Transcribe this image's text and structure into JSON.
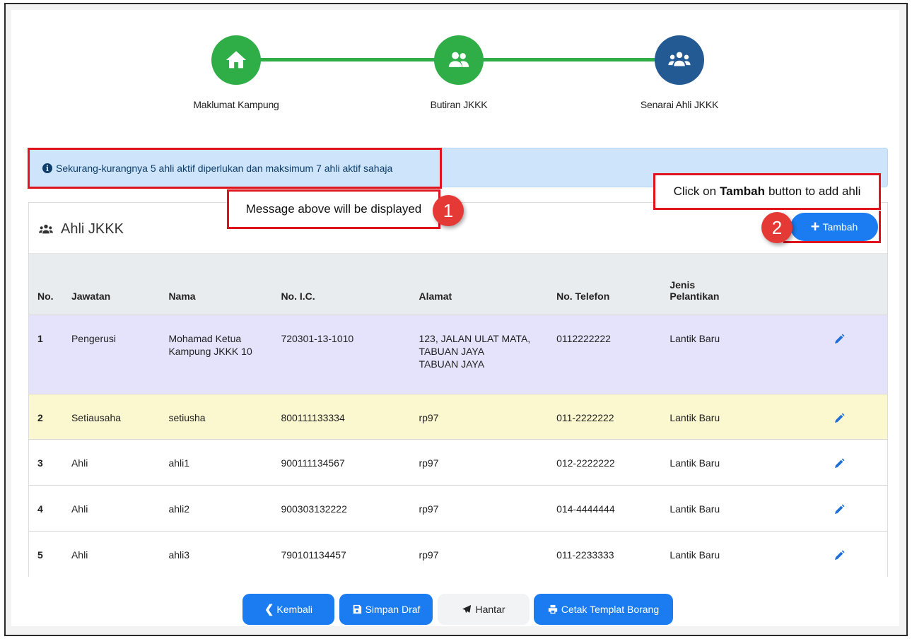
{
  "stepper": {
    "steps": [
      {
        "label": "Maklumat Kampung",
        "state": "done",
        "icon": "home-icon"
      },
      {
        "label": "Butiran JKKK",
        "state": "done",
        "icon": "users-icon"
      },
      {
        "label": "Senarai Ahli JKKK",
        "state": "active",
        "icon": "group-icon"
      }
    ],
    "colors": {
      "done": "#2fae48",
      "active": "#235a93"
    }
  },
  "alert": {
    "icon": "info-circle-icon",
    "message": "Sekurang-kurangnya 5 ahli aktif diperlukan dan maksimum 7 ahli aktif sahaja"
  },
  "annotations": {
    "callout1": "Message above will be displayed",
    "badge1": "1",
    "callout2_prefix": "Click on",
    "callout2_bold": "Tambah",
    "callout2_suffix": "button to add ahli",
    "badge2": "2"
  },
  "card": {
    "title": "Ahli JKKK",
    "title_icon": "group-icon",
    "add_button": "Tambah"
  },
  "table": {
    "columns": [
      "No.",
      "Jawatan",
      "Nama",
      "No. I.C.",
      "Alamat",
      "No. Telefon",
      "Jenis Pelantikan"
    ],
    "rows": [
      {
        "no": "1",
        "jawatan": "Pengerusi",
        "nama": "Mohamad Ketua Kampung JKKK 10",
        "ic": "720301-13-1010",
        "alamat_line1": "123, JALAN ULAT MATA,",
        "alamat_line2": "TABUAN JAYA",
        "alamat_line3": "TABUAN JAYA",
        "telefon": "0112222222",
        "pelantikan": "Lantik Baru"
      },
      {
        "no": "2",
        "jawatan": "Setiausaha",
        "nama": "setiusha",
        "ic": "800111133334",
        "alamat_line1": "rp97",
        "telefon": "011-2222222",
        "pelantikan": "Lantik Baru"
      },
      {
        "no": "3",
        "jawatan": "Ahli",
        "nama": "ahli1",
        "ic": "900111134567",
        "alamat_line1": "rp97",
        "telefon": "012-2222222",
        "pelantikan": "Lantik Baru"
      },
      {
        "no": "4",
        "jawatan": "Ahli",
        "nama": "ahli2",
        "ic": "900303132222",
        "alamat_line1": "rp97",
        "telefon": "014-4444444",
        "pelantikan": "Lantik Baru"
      },
      {
        "no": "5",
        "jawatan": "Ahli",
        "nama": "ahli3",
        "ic": "790101134457",
        "alamat_line1": "rp97",
        "telefon": "011-2233333",
        "pelantikan": "Lantik Baru"
      }
    ],
    "row_colors": {
      "row1": "#e4e3fb",
      "row2": "#fbf7cf"
    },
    "edit_icon": "pencil-icon"
  },
  "footer": {
    "back": "Kembali",
    "save_draft": "Simpan Draf",
    "submit": "Hantar",
    "print": "Cetak Templat Borang"
  },
  "accent": "#1a7cf0"
}
